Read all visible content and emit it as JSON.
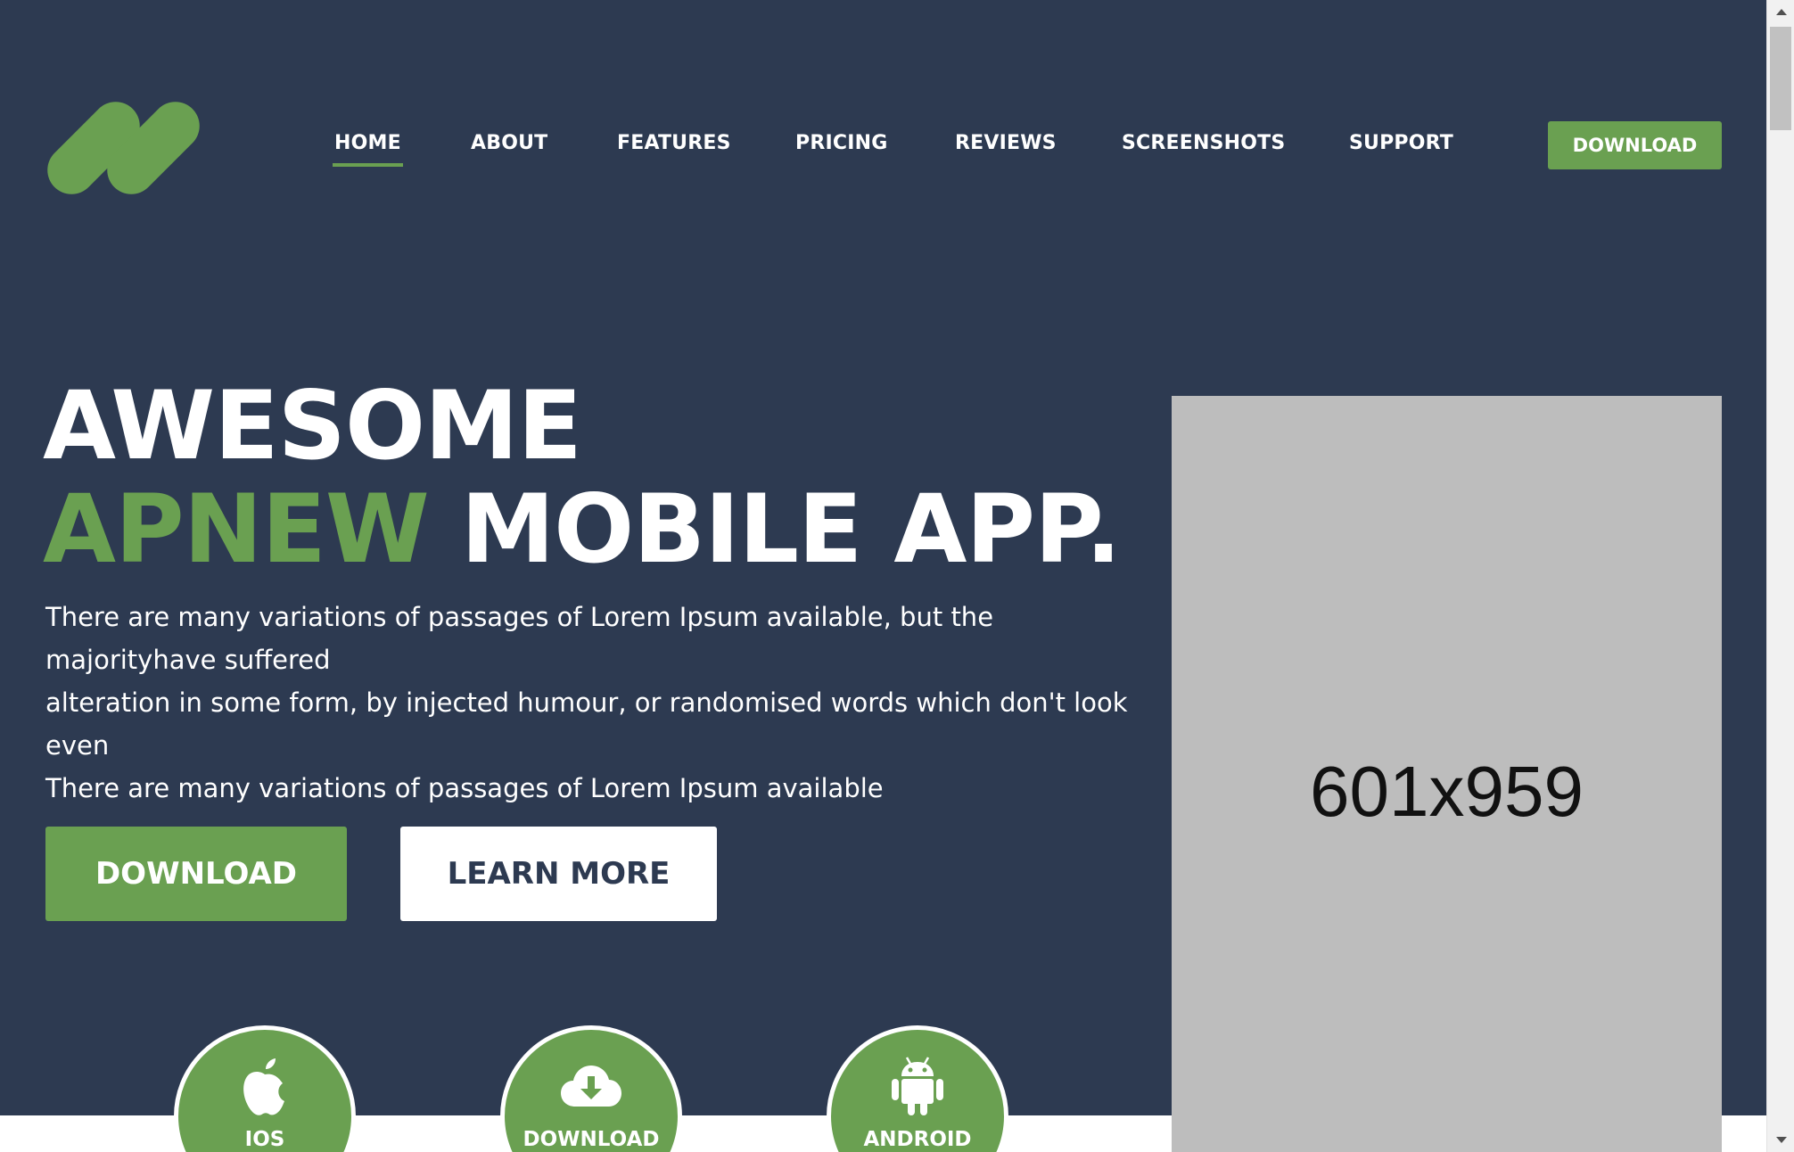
{
  "brand": {
    "logo_icon": "double-slash-logo",
    "accent_color": "#6aa051",
    "background_color": "#2d3a51"
  },
  "nav": {
    "items": [
      {
        "label": "HOME",
        "active": true
      },
      {
        "label": "ABOUT"
      },
      {
        "label": "FEATURES"
      },
      {
        "label": "PRICING"
      },
      {
        "label": "REVIEWS"
      },
      {
        "label": "SCREENSHOTS"
      },
      {
        "label": "SUPPORT"
      }
    ],
    "download_label": "DOWNLOAD"
  },
  "hero": {
    "line1": "AWESOME",
    "line2_accent": "APNEW",
    "line2_rest": "MOBILE APP.",
    "paragraph": [
      "There are many variations of passages of Lorem Ipsum available, but the majorityhave suffered",
      "alteration in some form, by injected humour, or randomised words which don't look even",
      "There are many variations of passages of Lorem Ipsum available"
    ],
    "primary_button": "DOWNLOAD",
    "secondary_button": "LEARN MORE",
    "image_placeholder_text": "601x959"
  },
  "stats": [
    {
      "icon": "apple-icon",
      "label": "IOS"
    },
    {
      "icon": "cloud-download-icon",
      "label": "DOWNLOAD"
    },
    {
      "icon": "android-icon",
      "label": "ANDROID"
    }
  ]
}
